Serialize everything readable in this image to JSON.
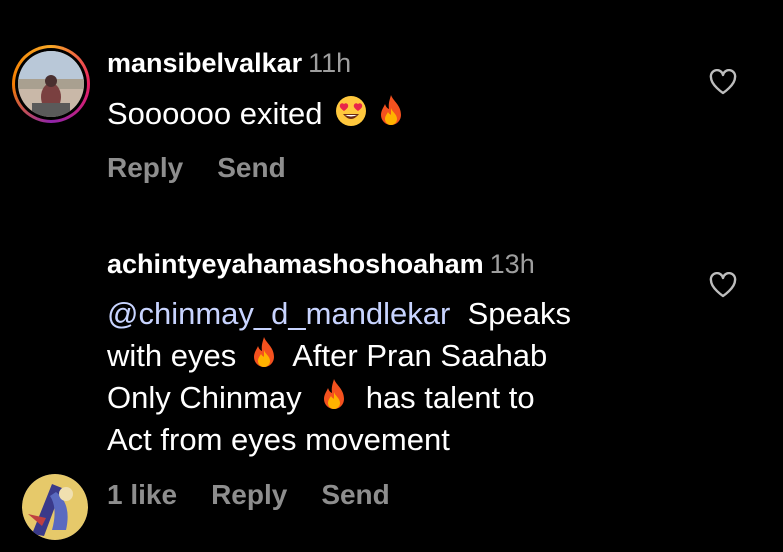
{
  "comments": [
    {
      "username": "mansibelvalkar",
      "time": "11h",
      "text": "Soooooo exited",
      "emojis": [
        "heart-eyes-emoji",
        "fire-emoji"
      ],
      "actions": {
        "reply": "Reply",
        "send": "Send"
      },
      "like_icon": "heart-outline-icon"
    },
    {
      "username": "achintyeyahamashoshoaham",
      "time": "13h",
      "mention": "@chinmay_d_mandlekar",
      "lines": [
        "Speaks",
        "with eyes",
        "After Pran Saahab",
        "Only Chinmay",
        "has talent to",
        "Act from eyes movement"
      ],
      "actions": {
        "likes": "1 like",
        "reply": "Reply",
        "send": "Send"
      },
      "like_icon": "heart-outline-icon"
    }
  ],
  "colors": {
    "background": "#000000",
    "text": "#ffffff",
    "muted": "#8e8e8e",
    "mention": "#c8d4ff"
  }
}
